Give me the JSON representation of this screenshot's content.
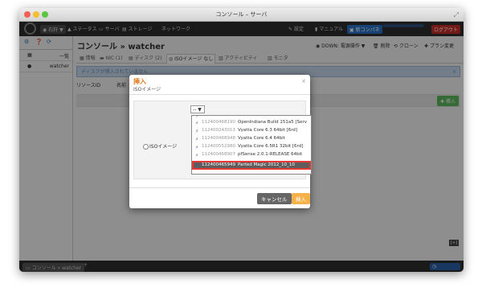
{
  "window": {
    "title": "コンソール – サーバ"
  },
  "menubar": {
    "zone_label": "石狩 ▼",
    "items": [
      "ステータス",
      "サーバ",
      "ストレージ",
      "ネットワーク"
    ],
    "right": {
      "settings": "設定",
      "manual": "マニュアル",
      "new_console": "新コンパネ",
      "account": "",
      "logout": "ログアウト"
    }
  },
  "sidebar": {
    "list_label": "一覧",
    "item": "watcher"
  },
  "page": {
    "title": "コンソール » watcher",
    "toolbar": {
      "power": "DOWN: 電源操作 ▼",
      "delete": "削除",
      "clone": "クローン",
      "plan": "プラン変更"
    },
    "tabs": [
      "情報",
      "NIC (1)",
      "ディスク (2)",
      "ISOイメージ なし",
      "アクティビティ",
      "モニタ"
    ],
    "info_message": "ディスクが挿入されていません",
    "columns": [
      "リソースID",
      "名前"
    ],
    "insert_button": "挿入"
  },
  "dialog": {
    "title": "挿入",
    "subtitle": "ISOイメージ",
    "field_label": "ISOイメージ",
    "select_value": "--",
    "options": [
      {
        "id": "",
        "name": ""
      },
      {
        "id": "112400468190",
        "name": "OpenIndiana Build 151a5 [Serv"
      },
      {
        "id": "112400243013",
        "name": "Vyatta Core 6.3 64bit [6rd]"
      },
      {
        "id": "112400468948",
        "name": "Vyatta Core 6.4 64bit"
      },
      {
        "id": "112400552980",
        "name": "Vyatta Core 6.5R1 32bit [6rd]"
      },
      {
        "id": "112400468907",
        "name": "pfSense 2.0.1-RELEASE 64bit"
      },
      {
        "id": "112400465949",
        "name": "Parted Magic 2012_10_10"
      }
    ],
    "cancel": "キャンセル",
    "insert": "挿入"
  },
  "bottombar": {
    "tab": "コンソール » watcher",
    "plus": "+",
    "status": "",
    "expand": "[+]"
  }
}
